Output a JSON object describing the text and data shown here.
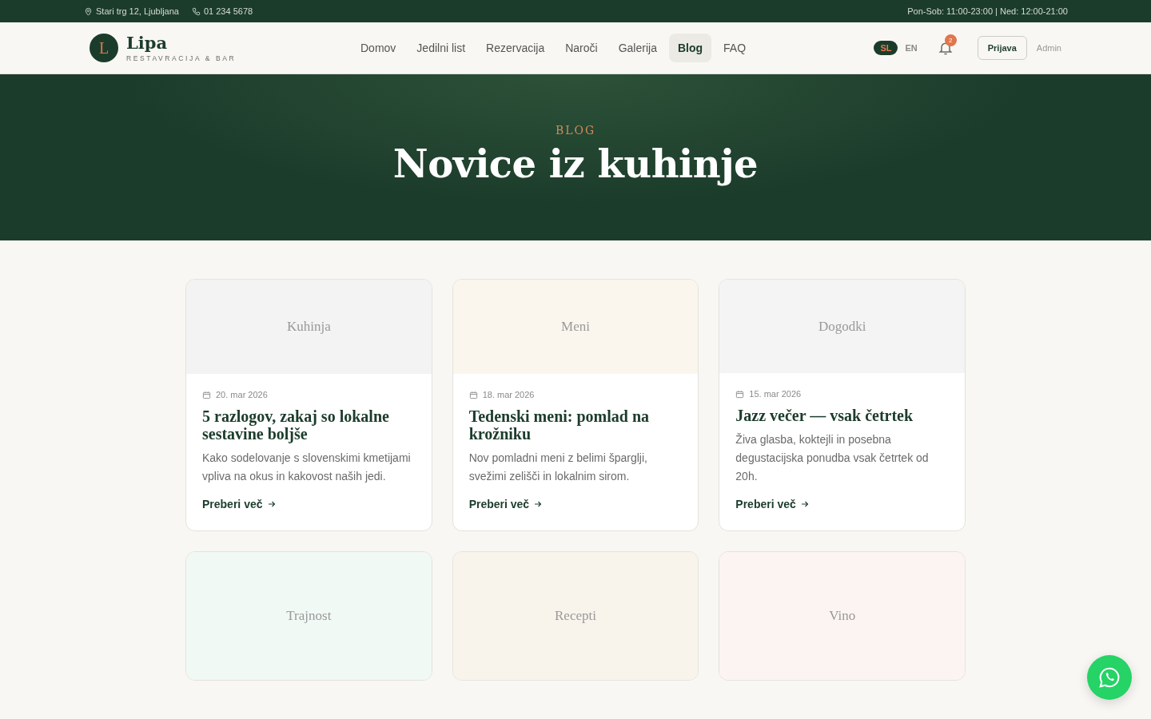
{
  "topbar": {
    "address": "Stari trg 12, Ljubljana",
    "phone": "01 234 5678",
    "hours": "Pon-Sob: 11:00-23:00 | Ned: 12:00-21:00"
  },
  "brand": {
    "initial": "L",
    "name": "Lipa",
    "tagline": "RESTAVRACIJA & BAR"
  },
  "nav": [
    {
      "label": "Domov",
      "selected": false
    },
    {
      "label": "Jedilni list",
      "selected": false
    },
    {
      "label": "Rezervacija",
      "selected": false
    },
    {
      "label": "Naroči",
      "selected": false
    },
    {
      "label": "Galerija",
      "selected": false
    },
    {
      "label": "Blog",
      "selected": true
    },
    {
      "label": "FAQ",
      "selected": false
    }
  ],
  "languages": [
    {
      "label": "SL",
      "selected": true
    },
    {
      "label": "EN",
      "selected": false
    }
  ],
  "notifications": {
    "count": "2"
  },
  "login": "Prijava",
  "admin": "Admin",
  "hero": {
    "eyebrow": "BLOG",
    "title": "Novice iz kuhinje"
  },
  "posts": [
    {
      "category": "Kuhinja",
      "color": "#f3f3f3",
      "date": "20. mar 2026",
      "title": "5 razlogov, zakaj so lokalne sestavine boljše",
      "excerpt": "Kako sodelovanje s slovenskimi kmetijami vpliva na okus in kakovost naših jedi.",
      "link": "Preberi več"
    },
    {
      "category": "Meni",
      "color": "#faf6ed",
      "date": "18. mar 2026",
      "title": "Tedenski meni: pomlad na krožniku",
      "excerpt": "Nov pomladni meni z belimi šparglji, svežimi zelišči in lokalnim sirom.",
      "link": "Preberi več"
    },
    {
      "category": "Dogodki",
      "color": "#f3f4f3",
      "date": "15. mar 2026",
      "title": "Jazz večer — vsak četrtek",
      "excerpt": "Živa glasba, koktejli in posebna degustacijska ponudba vsak četrtek od 20h.",
      "link": "Preberi več"
    },
    {
      "category": "Trajnost",
      "color": "#f1f9f5"
    },
    {
      "category": "Recepti",
      "color": "#f8f4ec"
    },
    {
      "category": "Vino",
      "color": "#fcf4f2"
    }
  ]
}
